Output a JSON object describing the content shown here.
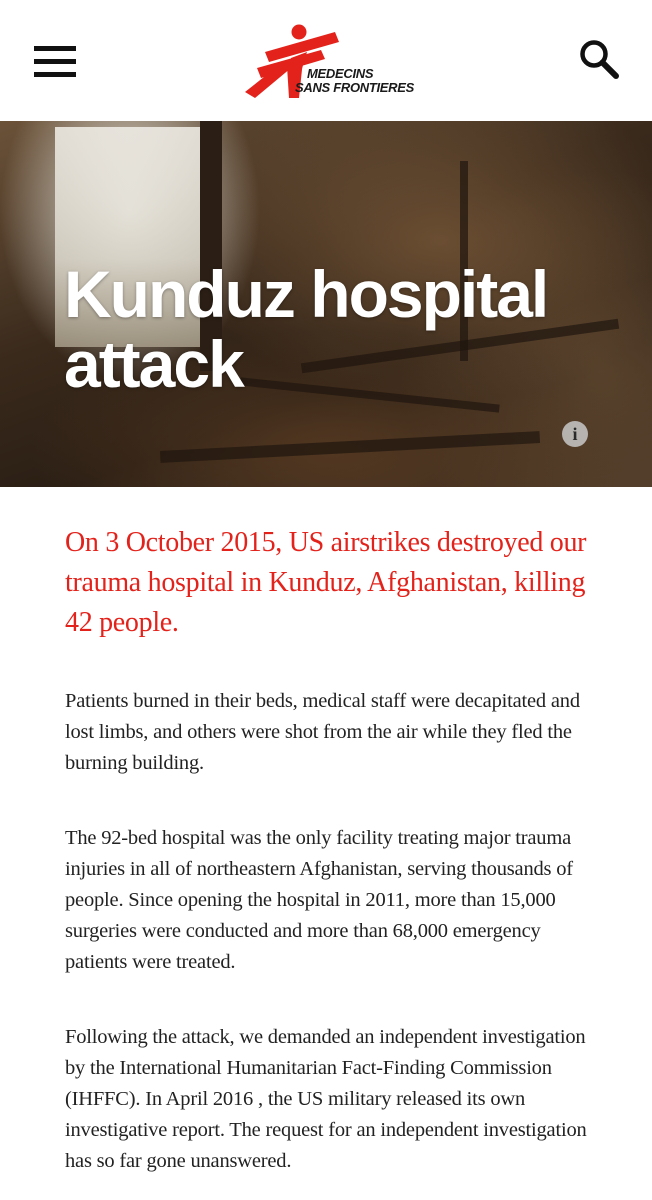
{
  "header": {
    "logo_line1": "MEDECINS",
    "logo_line2": "SANS FRONTIERES",
    "brand_color": "#e3231b",
    "menu_icon": "hamburger-menu-icon",
    "search_icon": "search-icon"
  },
  "hero": {
    "title": "Kunduz hospital attack",
    "info_icon": "info-icon",
    "info_glyph": "i"
  },
  "article": {
    "lead": "On 3 October 2015, US airstrikes destroyed our trauma hospital in Kunduz, Afghanistan, killing 42 people.",
    "paragraphs": [
      "Patients burned in their beds, medical staff were decapitated and lost limbs, and others were shot from the air while they fled the burning building.",
      "The 92-bed hospital was the only facility treating major trauma injuries in all of northeastern Afghanistan, serving thousands of people. Since opening the hospital in 2011, more than 15,000 surgeries were conducted and more than 68,000 emergency patients were treated.",
      "Following the attack, we demanded an independent investigation by the International Humanitarian Fact-Finding Commission (IHFFC). In April 2016 , the US military released its own investigative report. The request for an independent investigation has so far gone unanswered."
    ]
  }
}
